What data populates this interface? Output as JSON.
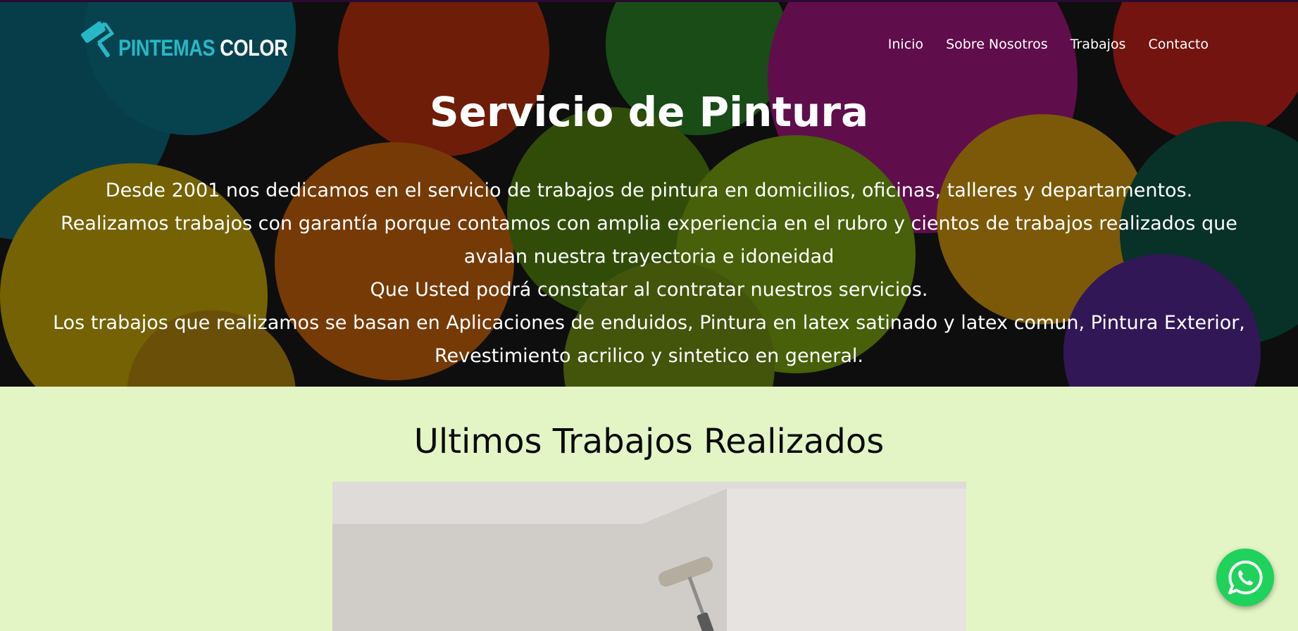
{
  "header": {
    "logo_word1": "PINTEMAS",
    "logo_word2": "COLOR",
    "logo_icon": "paint-roller-icon",
    "nav": [
      "Inicio",
      "Sobre Nosotros",
      "Trabajos",
      "Contacto"
    ]
  },
  "hero": {
    "title": "Servicio de Pintura",
    "lines": [
      "Desde 2001 nos dedicamos en el servicio de trabajos de pintura en domicilios, oficinas, talleres y departamentos.",
      "Realizamos trabajos con garantía porque contamos con amplia experiencia en el rubro y cientos de trabajos realizados que avalan nuestra trayectoria e idoneidad",
      "Que Usted podrá constatar al contratar nuestros servicios.",
      "Los trabajos que realizamos se basan en Aplicaciones de enduidos, Pintura en latex satinado y latex comun, Pintura Exterior, Revestimiento acrilico y sintetico en general."
    ]
  },
  "works": {
    "title": "Ultimos Trabajos Realizados"
  },
  "floating": {
    "whatsapp_icon": "whatsapp-icon"
  },
  "colors": {
    "accent": "#26b8c6",
    "section_bg": "#e4f5c5",
    "whatsapp": "#1fd25b"
  }
}
